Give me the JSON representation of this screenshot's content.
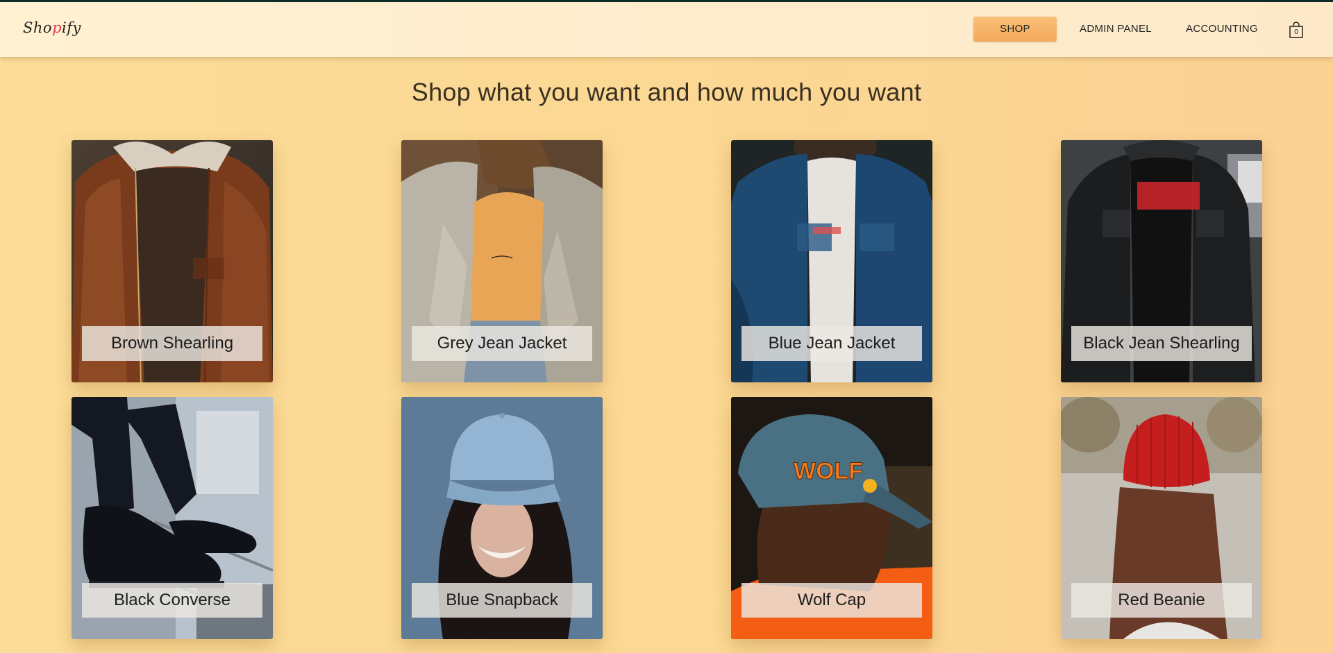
{
  "header": {
    "logo_prefix": "Sho",
    "logo_accent": "p",
    "logo_suffix": "ify",
    "nav": {
      "shop": "SHOP",
      "admin": "ADMIN PANEL",
      "accounting": "ACCOUNTING"
    },
    "cart_count": "0"
  },
  "main": {
    "heading": "Shop what you want and how much you want",
    "products": [
      {
        "name": "Brown Shearling"
      },
      {
        "name": "Grey Jean Jacket"
      },
      {
        "name": "Blue Jean Jacket"
      },
      {
        "name": "Black Jean Shearling"
      },
      {
        "name": "Black Converse"
      },
      {
        "name": "Blue Snapback"
      },
      {
        "name": "Wolf Cap"
      },
      {
        "name": "Red Beanie"
      }
    ]
  },
  "colors": {
    "page_bg": "#fbd893",
    "nav_bg": "#fff1d2",
    "shop_button": "#f6b068",
    "logo_accent": "#e63c5a"
  }
}
